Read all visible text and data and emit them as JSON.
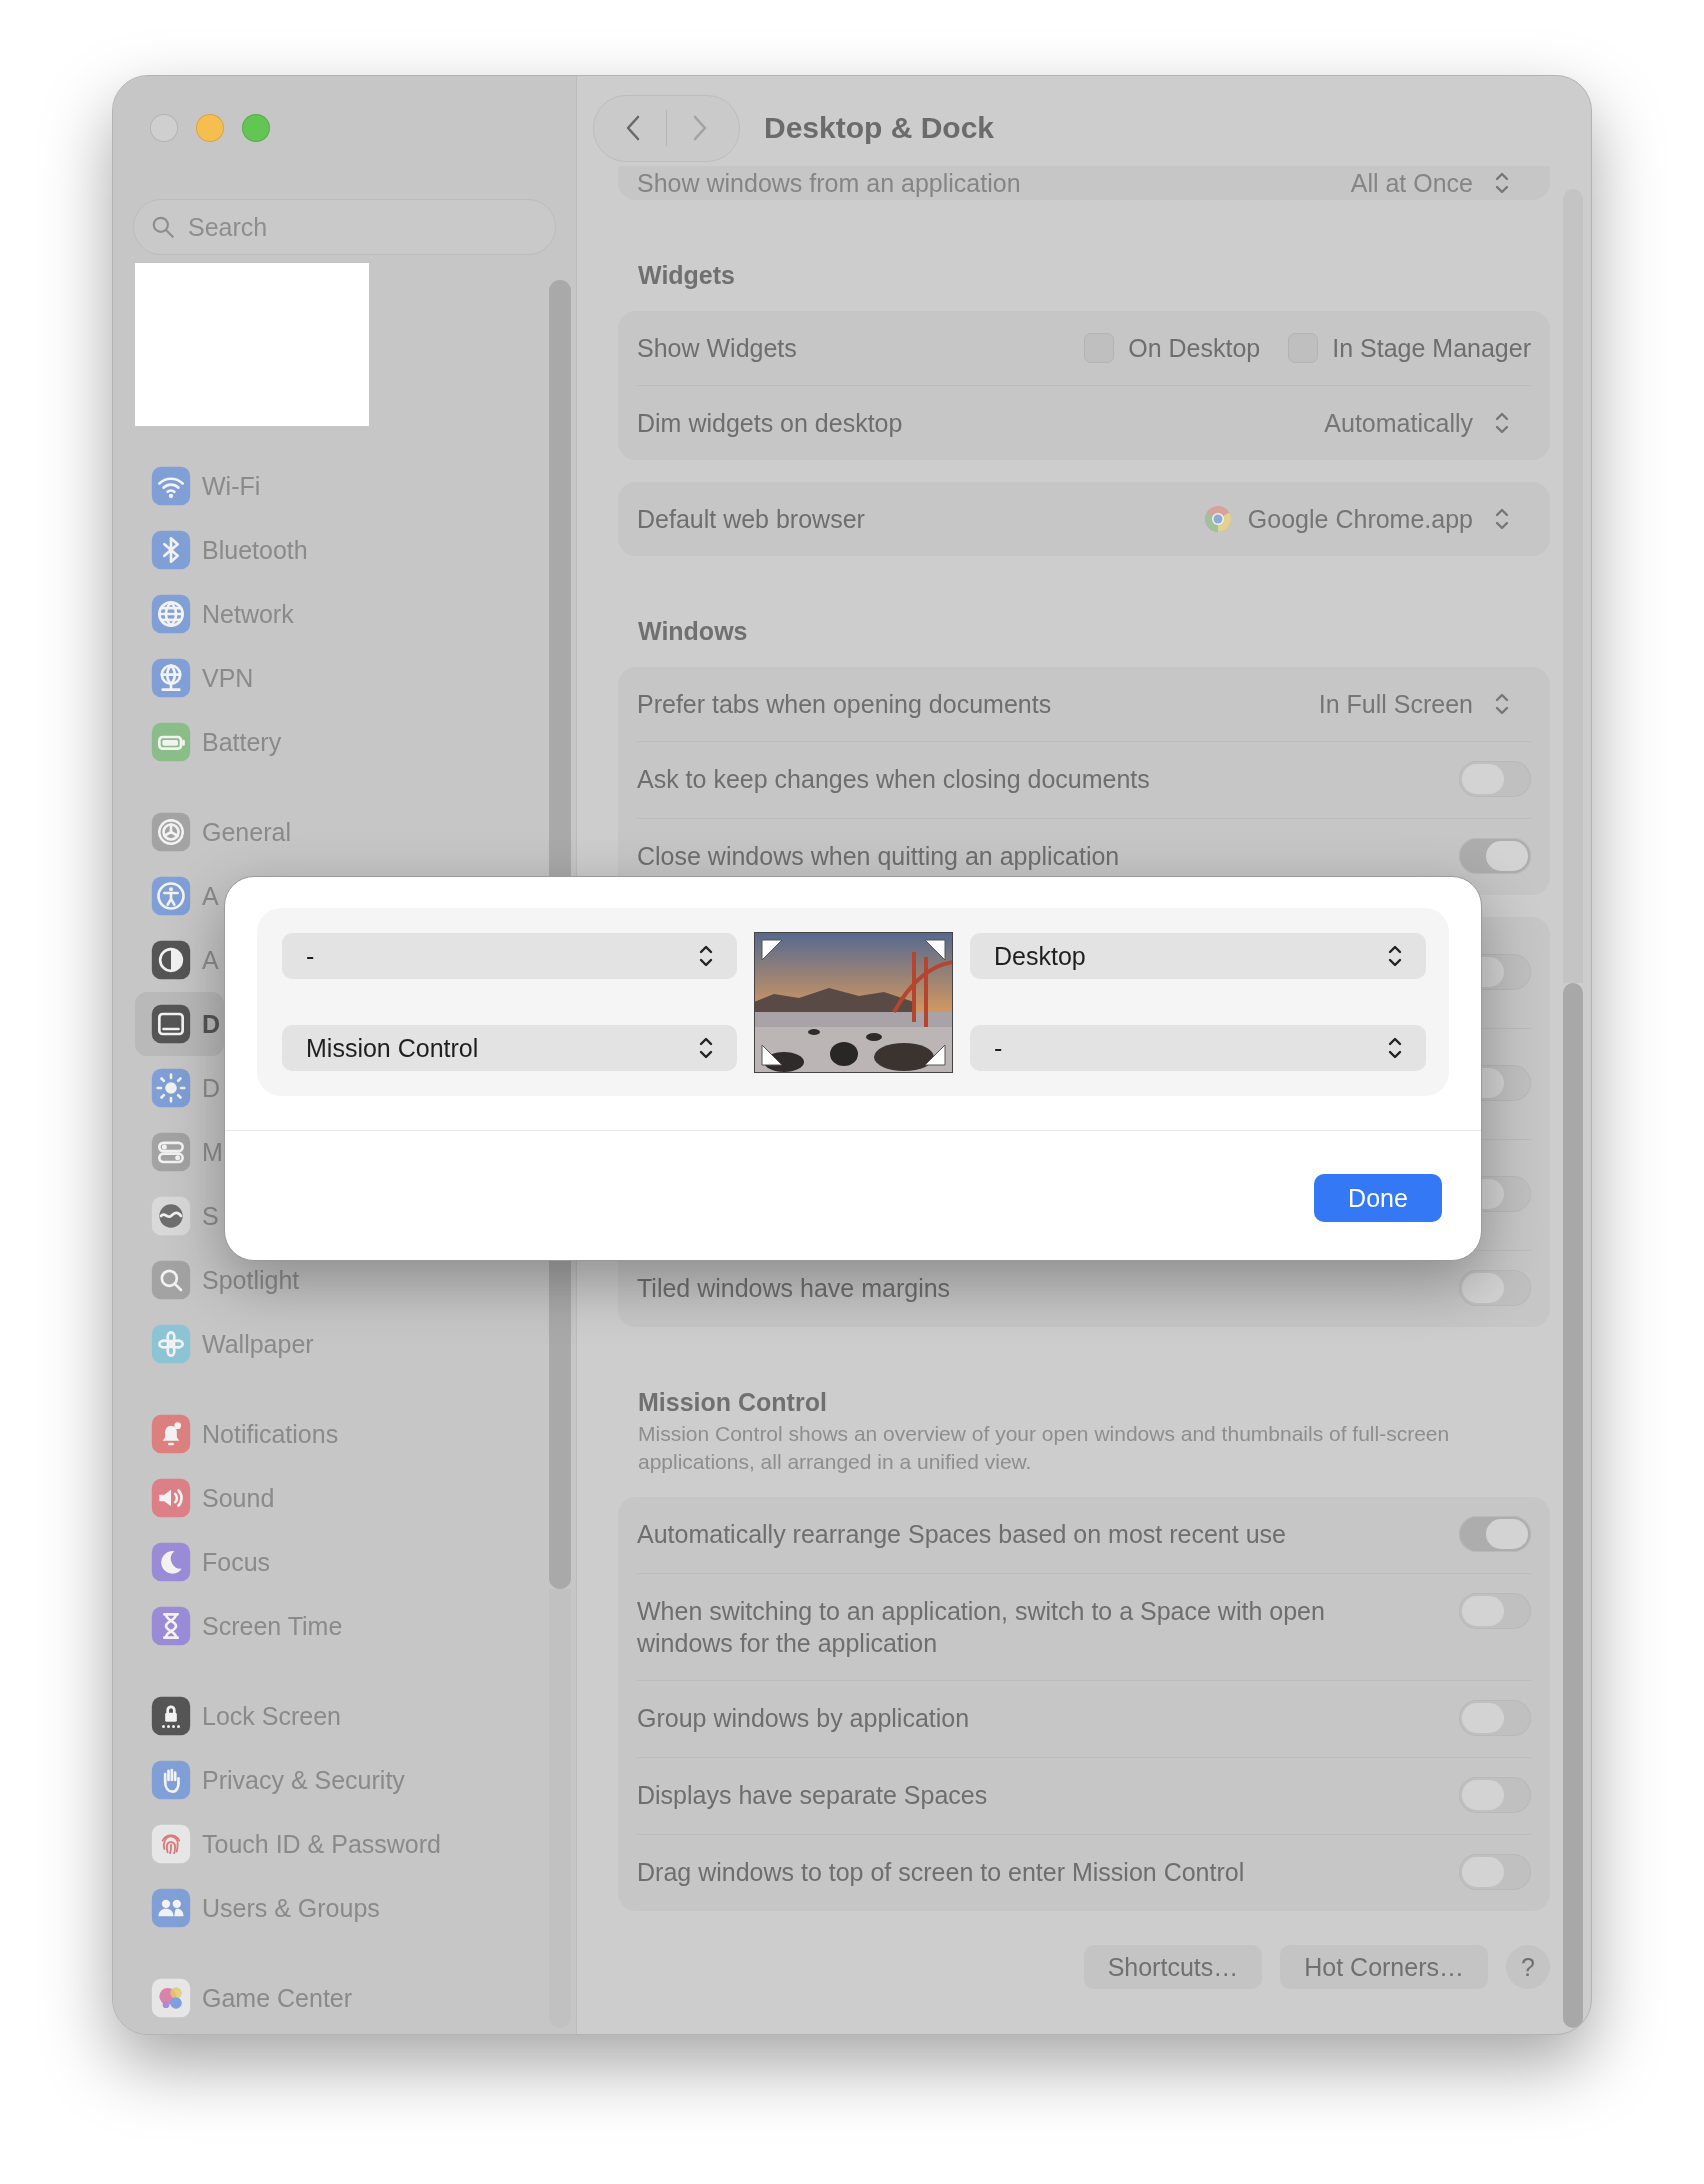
{
  "window": {
    "title": "Desktop & Dock"
  },
  "window_controls": [
    {
      "kind": "close",
      "disabled": true
    },
    {
      "kind": "minimize",
      "disabled": false
    },
    {
      "kind": "zoom",
      "disabled": false
    }
  ],
  "sidebar": {
    "search": {
      "placeholder": "Search"
    },
    "groups": [
      [
        {
          "label": "Wi-Fi",
          "kind": "wifi",
          "color": "#7f9fd6",
          "selected": false
        },
        {
          "label": "Bluetooth",
          "kind": "bluetooth",
          "color": "#7f9fd6",
          "selected": false
        },
        {
          "label": "Network",
          "kind": "network",
          "color": "#7f9fd6",
          "selected": false
        },
        {
          "label": "VPN",
          "kind": "vpn",
          "color": "#7f9fd6",
          "selected": false
        },
        {
          "label": "Battery",
          "kind": "battery",
          "color": "#8bbd88",
          "selected": false
        }
      ],
      [
        {
          "label": "General",
          "kind": "general",
          "color": "#a3a3a3",
          "selected": false
        },
        {
          "label": "A",
          "kind": "accessibility",
          "color": "#7f9fd6",
          "selected": false
        },
        {
          "label": "A",
          "kind": "appearance",
          "color": "#555555",
          "selected": false
        },
        {
          "label": "D",
          "kind": "dock",
          "color": "#555555",
          "selected": true
        },
        {
          "label": "D",
          "kind": "displays",
          "color": "#7f9fd6",
          "selected": false
        },
        {
          "label": "M",
          "kind": "menubar",
          "color": "#a3a3a3",
          "selected": false
        },
        {
          "label": "S",
          "kind": "siri",
          "color": "#d9d9d9",
          "selected": false
        },
        {
          "label": "Spotlight",
          "kind": "spotlight",
          "color": "#a3a3a3",
          "selected": false
        },
        {
          "label": "Wallpaper",
          "kind": "wallpaper",
          "color": "#8cc4d6",
          "selected": false
        }
      ],
      [
        {
          "label": "Notifications",
          "kind": "notifications",
          "color": "#dc7f7f",
          "selected": false
        },
        {
          "label": "Sound",
          "kind": "sound",
          "color": "#dc7f86",
          "selected": false
        },
        {
          "label": "Focus",
          "kind": "focus",
          "color": "#9a8bd6",
          "selected": false
        },
        {
          "label": "Screen Time",
          "kind": "screentime",
          "color": "#9a8bd6",
          "selected": false
        }
      ],
      [
        {
          "label": "Lock Screen",
          "kind": "lock",
          "color": "#555555",
          "selected": false
        },
        {
          "label": "Privacy & Security",
          "kind": "privacy",
          "color": "#7f9fd6",
          "selected": false
        },
        {
          "label": "Touch ID & Password",
          "kind": "touchid",
          "color": "#e6e6e6",
          "selected": false
        },
        {
          "label": "Users & Groups",
          "kind": "users",
          "color": "#7f9fd6",
          "selected": false
        }
      ],
      [
        {
          "label": "Game Center",
          "kind": "gamecenter",
          "color": "#e6e6e6",
          "selected": false
        }
      ]
    ]
  },
  "sections": [
    {
      "cards": [
        {
          "clipped": true,
          "rows": [
            {
              "kind": "popup",
              "label": "Show windows from an application",
              "value": "All at Once"
            }
          ]
        }
      ]
    },
    {
      "title": "Widgets",
      "cards": [
        {
          "rows": [
            {
              "kind": "checkboxes",
              "label": "Show Widgets",
              "options": [
                {
                  "label": "On Desktop",
                  "checked": false
                },
                {
                  "label": "In Stage Manager",
                  "checked": false
                }
              ]
            },
            {
              "kind": "popup",
              "label": "Dim widgets on desktop",
              "value": "Automatically"
            }
          ]
        },
        {
          "rows": [
            {
              "kind": "app_popup",
              "label": "Default web browser",
              "value": "Google Chrome.app"
            }
          ]
        }
      ]
    },
    {
      "title": "Windows",
      "cards": [
        {
          "rows": [
            {
              "kind": "popup",
              "label": "Prefer tabs when opening documents",
              "value": "In Full Screen"
            },
            {
              "kind": "toggle",
              "label": "Ask to keep changes when closing documents",
              "on": false
            },
            {
              "kind": "toggle",
              "label": "Close windows when quitting an application",
              "on": true
            }
          ]
        },
        {
          "rows": [
            {
              "kind": "toggle",
              "on": false
            },
            {
              "kind": "toggle",
              "on": false
            },
            {
              "kind": "toggle",
              "on": false
            },
            {
              "kind": "toggle",
              "label": "Tiled windows have margins",
              "on": false
            }
          ]
        }
      ]
    },
    {
      "title": "Mission Control",
      "description": "Mission Control shows an overview of your open windows and thumbnails of full-screen applications, all arranged in a unified view.",
      "cards": [
        {
          "rows": [
            {
              "kind": "toggle",
              "label": "Automatically rearrange Spaces based on most recent use",
              "on": true
            },
            {
              "kind": "toggle",
              "label": "When switching to an application, switch to a Space with open windows for the application",
              "on": false
            },
            {
              "kind": "toggle",
              "label": "Group windows by application",
              "on": false
            },
            {
              "kind": "toggle",
              "label": "Displays have separate Spaces",
              "on": false
            },
            {
              "kind": "toggle",
              "label": "Drag windows to top of screen to enter Mission Control",
              "on": false
            }
          ]
        }
      ]
    }
  ],
  "buttons": [
    {
      "kind": "text",
      "label": "Shortcuts…"
    },
    {
      "kind": "text",
      "label": "Hot Corners…"
    },
    {
      "kind": "help",
      "label": "?"
    }
  ],
  "hot_corners_sheet": {
    "corners": [
      {
        "value": "-"
      },
      {
        "value": "Desktop"
      },
      {
        "value": "Mission Control"
      },
      {
        "value": "-"
      }
    ],
    "done_button": "Done"
  }
}
